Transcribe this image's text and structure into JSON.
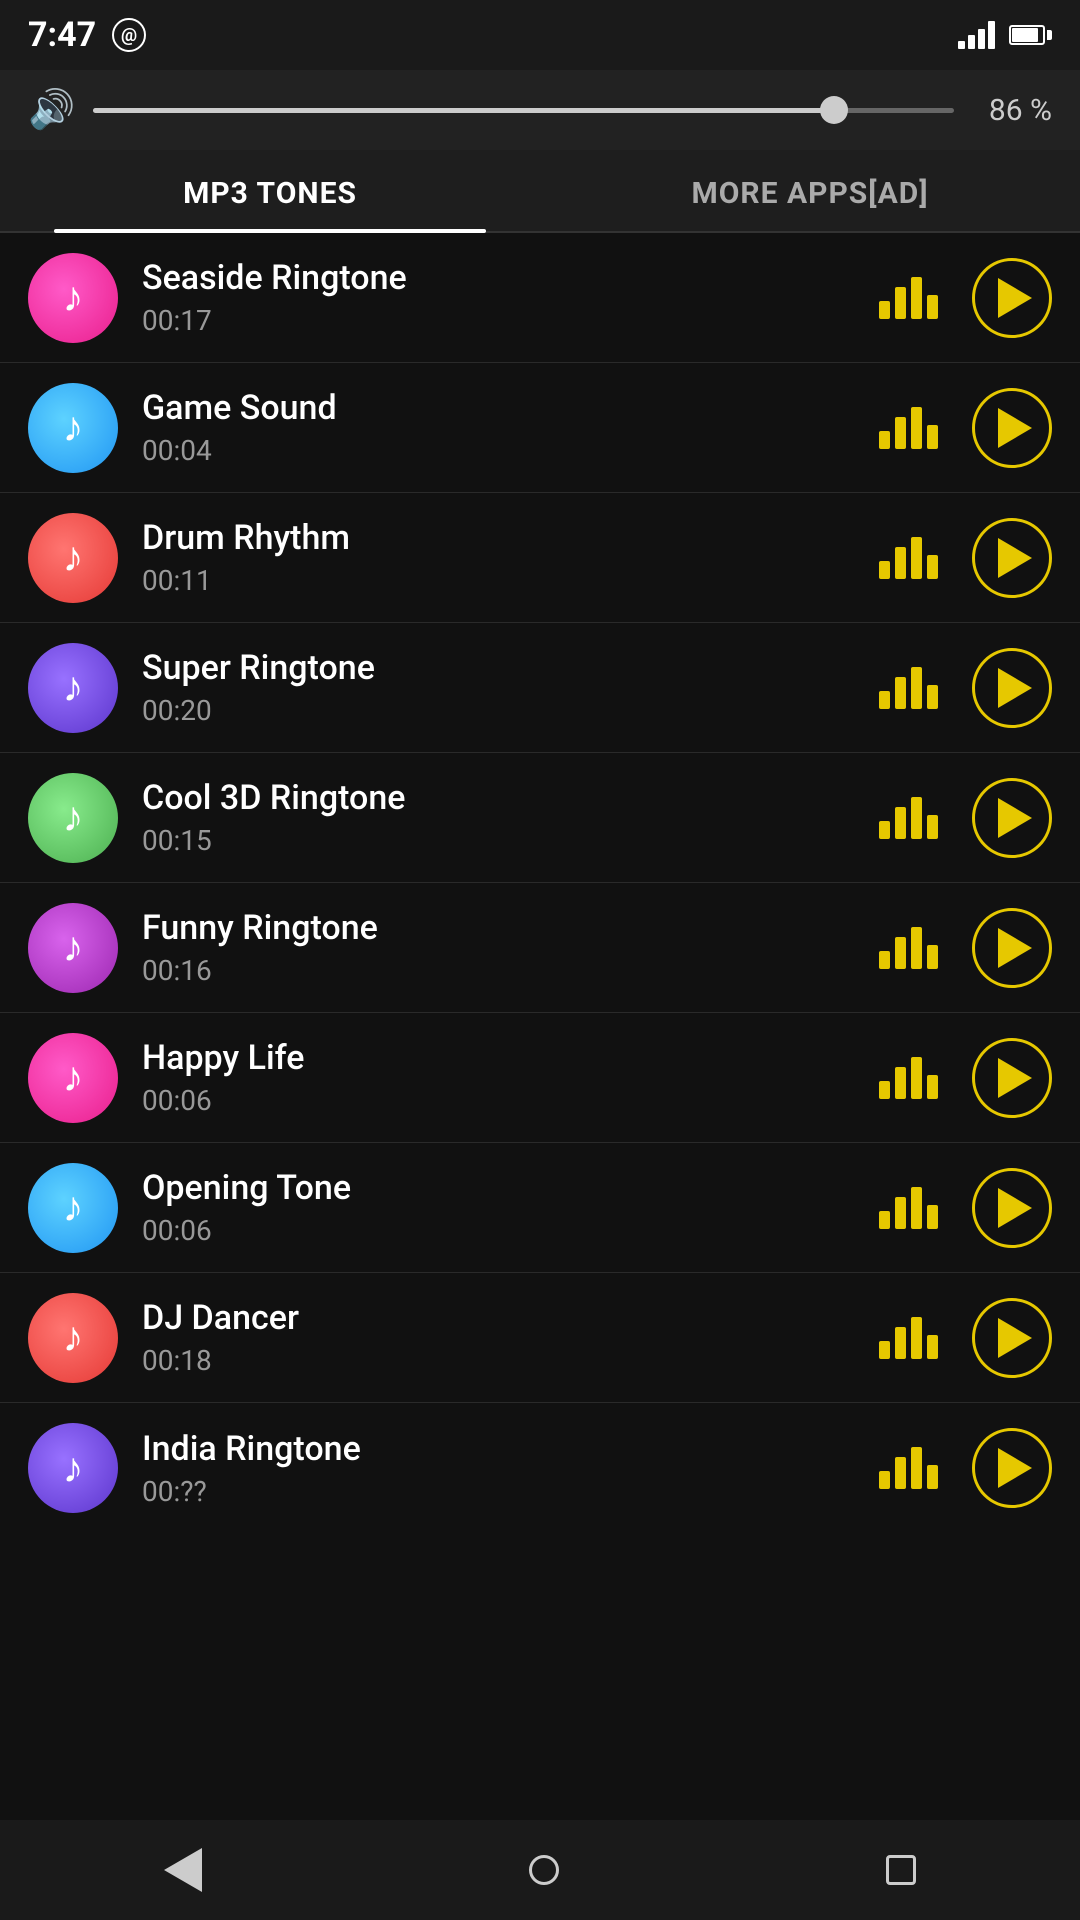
{
  "statusBar": {
    "time": "7:47",
    "volume_pct": "86 %"
  },
  "tabs": [
    {
      "id": "mp3",
      "label": "MP3 TONES",
      "active": true
    },
    {
      "id": "more",
      "label": "MORE APPS[AD]",
      "active": false
    }
  ],
  "ringtones": [
    {
      "id": 1,
      "name": "Seaside Ringtone",
      "duration": "00:17",
      "color": "#e91e8c"
    },
    {
      "id": 2,
      "name": "Game Sound",
      "duration": "00:04",
      "color": "#2196f3"
    },
    {
      "id": 3,
      "name": "Drum Rhythm",
      "duration": "00:11",
      "color": "#e53935"
    },
    {
      "id": 4,
      "name": "Super Ringtone",
      "duration": "00:20",
      "color": "#5c35cc"
    },
    {
      "id": 5,
      "name": "Cool 3D Ringtone",
      "duration": "00:15",
      "color": "#4caf50"
    },
    {
      "id": 6,
      "name": "Funny Ringtone",
      "duration": "00:16",
      "color": "#9c27b0"
    },
    {
      "id": 7,
      "name": "Happy Life",
      "duration": "00:06",
      "color": "#e91e8c"
    },
    {
      "id": 8,
      "name": "Opening Tone",
      "duration": "00:06",
      "color": "#2196f3"
    },
    {
      "id": 9,
      "name": "DJ Dancer",
      "duration": "00:18",
      "color": "#e53935"
    },
    {
      "id": 10,
      "name": "India Ringtone",
      "duration": "00:??",
      "color": "#5c35cc"
    }
  ]
}
